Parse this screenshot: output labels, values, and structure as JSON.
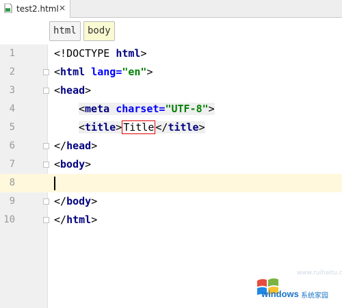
{
  "tab": {
    "filename": "test2.html",
    "close_glyph": "✕",
    "icon": "html-file-icon"
  },
  "breadcrumbs": [
    {
      "label": "html"
    },
    {
      "label": "body"
    }
  ],
  "colors": {
    "tag": "#000080",
    "attribute": "#0000ff",
    "string": "#008000",
    "current_line": "#fff8dc",
    "highlight_box": "#e00000"
  },
  "lines": [
    {
      "num": "1",
      "text": "<!DOCTYPE html>"
    },
    {
      "num": "2",
      "text": "<html lang=\"en\">"
    },
    {
      "num": "3",
      "text": "<head>"
    },
    {
      "num": "4",
      "text": "<meta charset=\"UTF-8\">"
    },
    {
      "num": "5",
      "text": "<title>Title</title>"
    },
    {
      "num": "6",
      "text": "</head>"
    },
    {
      "num": "7",
      "text": "<body>"
    },
    {
      "num": "8",
      "text": ""
    },
    {
      "num": "9",
      "text": "</body>"
    },
    {
      "num": "10",
      "text": "</html>"
    }
  ],
  "code": {
    "l1_open": "<!",
    "l1_doctype": "DOCTYPE",
    "l1_html": "html",
    "l1_close": ">",
    "l2_open": "<",
    "l2_tag": "html",
    "l2_attr": "lang",
    "l2_eq": "=",
    "l2_val": "\"en\"",
    "l2_close": ">",
    "l3_open": "<",
    "l3_tag": "head",
    "l3_close": ">",
    "l4_open": "<",
    "l4_tag": "meta",
    "l4_attr": "charset",
    "l4_eq": "=",
    "l4_val": "\"UTF-8\"",
    "l4_close": ">",
    "l5_open": "<",
    "l5_tag": "title",
    "l5_close": ">",
    "l5_text": "Title",
    "l5_end_open": "</",
    "l5_end_tag": "title",
    "l5_end_close": ">",
    "l6_open": "</",
    "l6_tag": "head",
    "l6_close": ">",
    "l7_open": "<",
    "l7_tag": "body",
    "l7_close": ">",
    "l9_open": "</",
    "l9_tag": "body",
    "l9_close": ">",
    "l10_open": "</",
    "l10_tag": "html",
    "l10_close": ">"
  },
  "current_line": "8",
  "watermark": {
    "brand": "windows",
    "sub": "系统家园",
    "url": "www.ruihaitu.com"
  }
}
